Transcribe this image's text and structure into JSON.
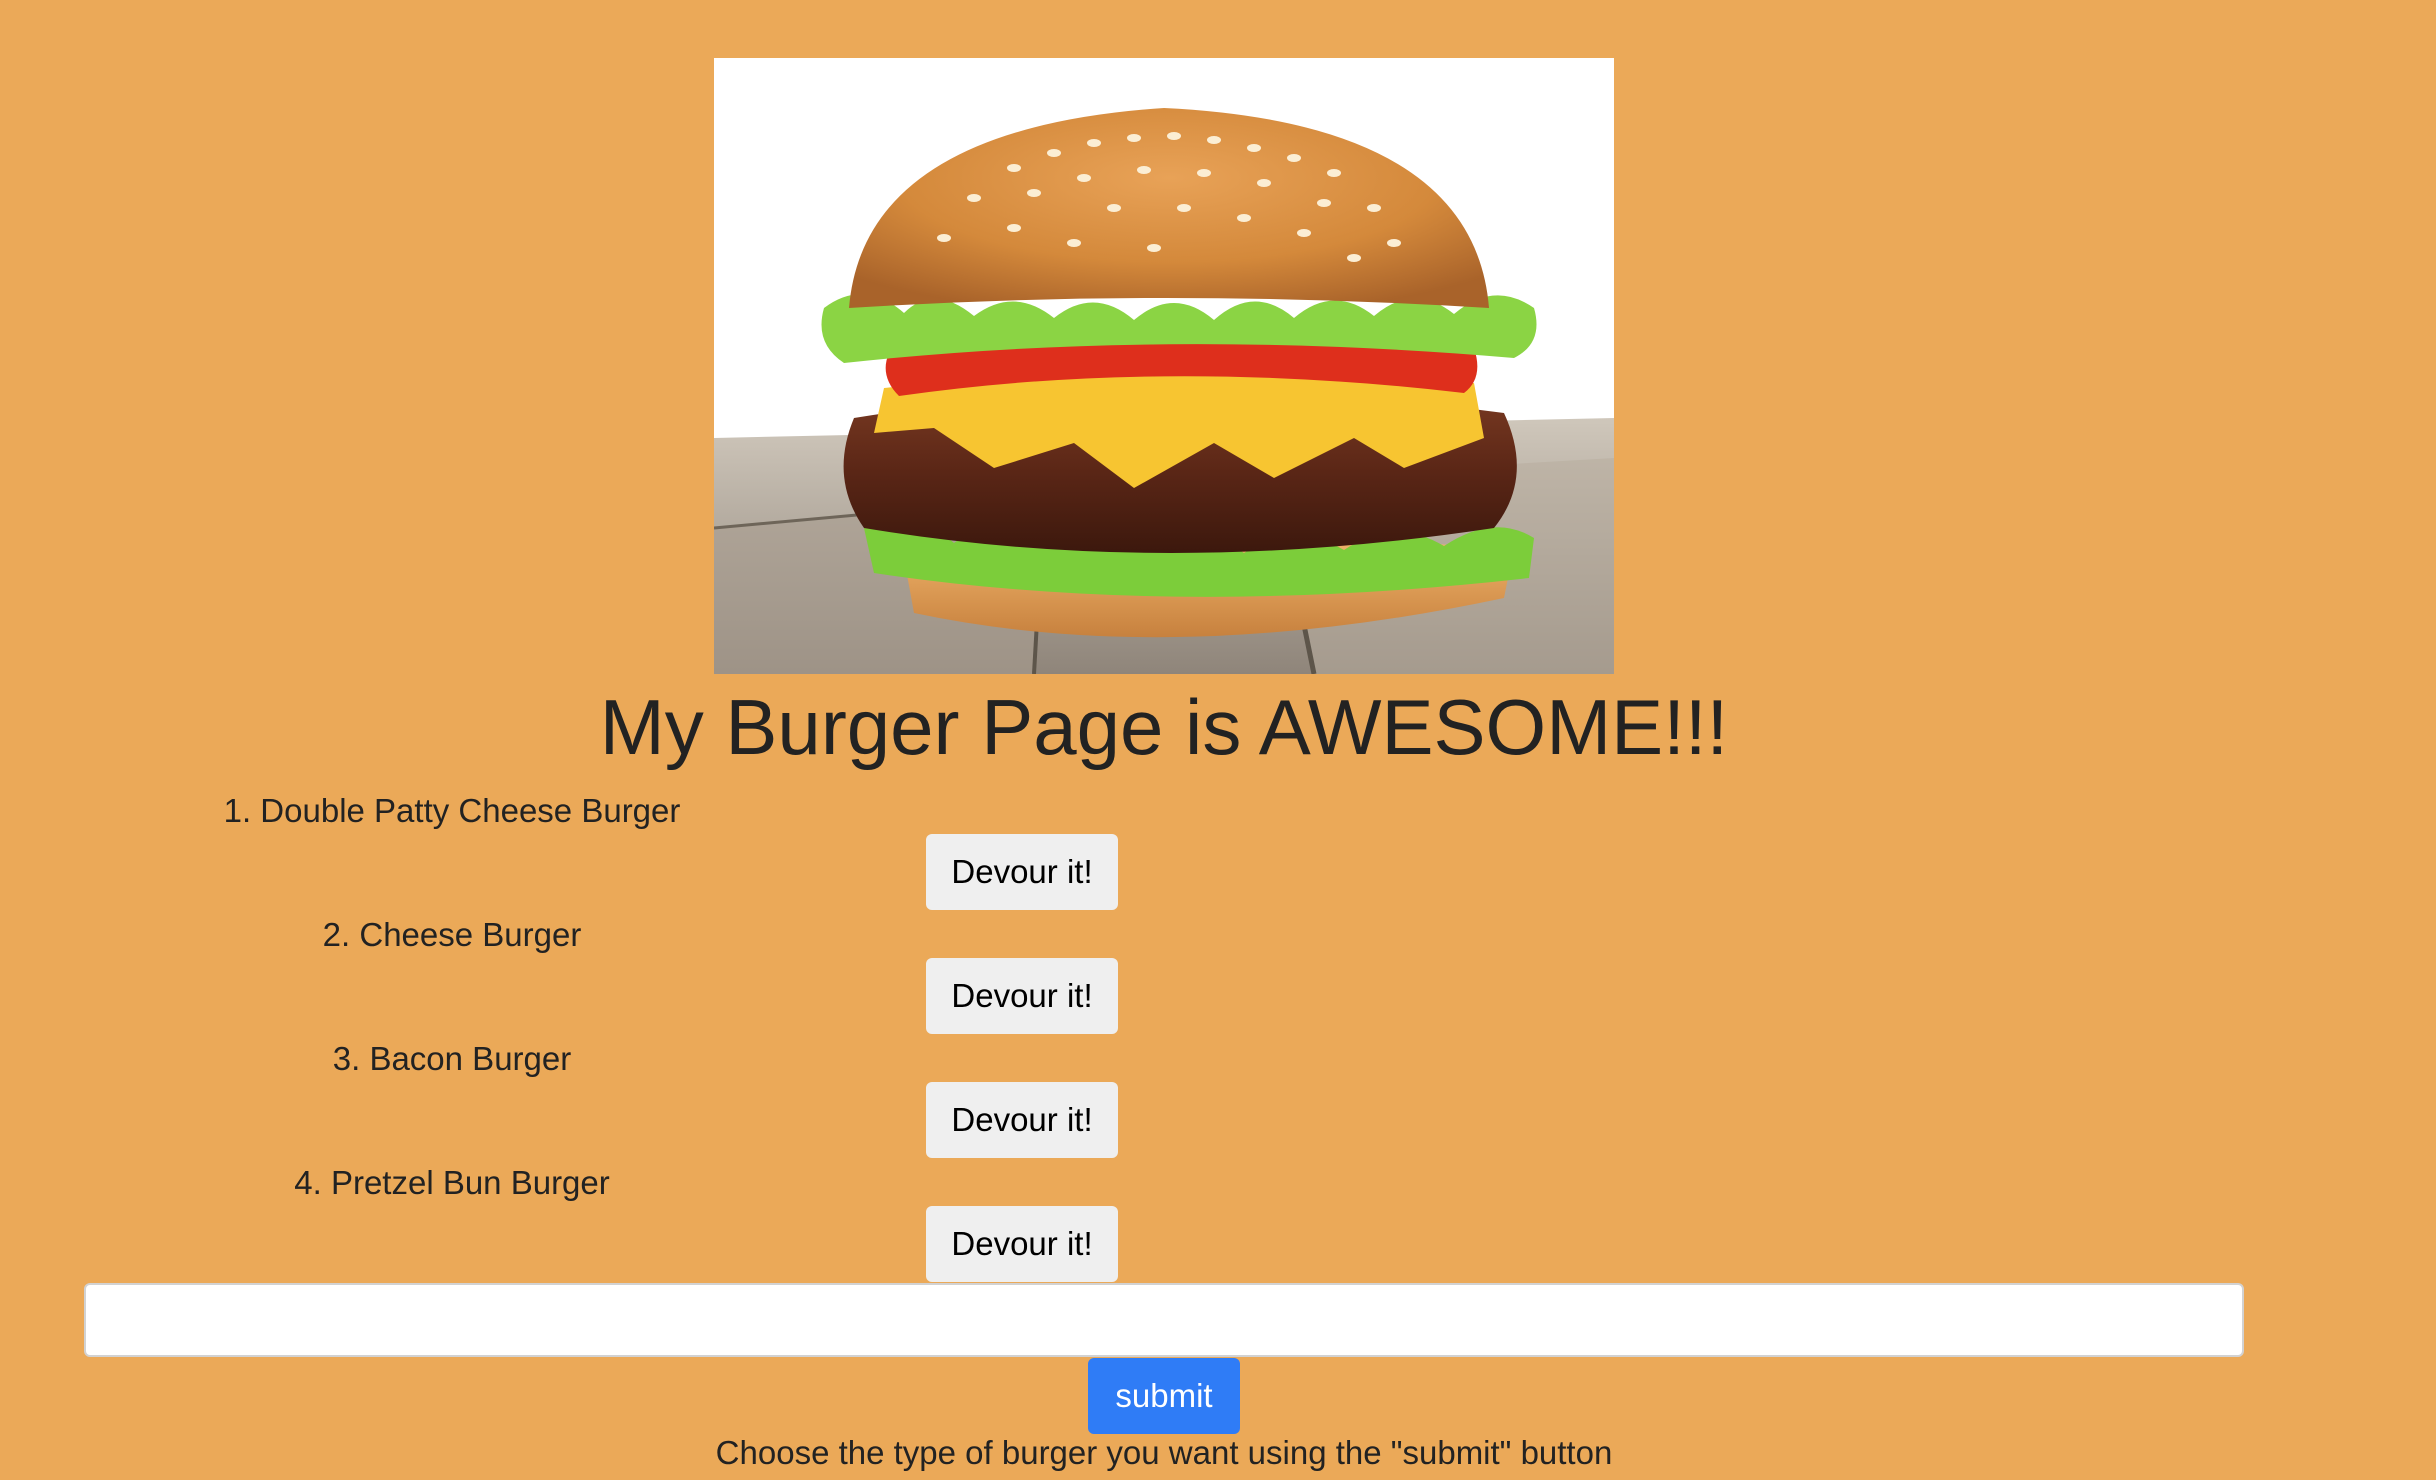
{
  "hero_image": {
    "alt": "cheeseburger-photo"
  },
  "page": {
    "title": "My Burger Page is AWESOME!!!"
  },
  "burgers": [
    {
      "label": "1. Double Patty Cheese Burger",
      "button_label": "Devour it!"
    },
    {
      "label": "2. Cheese Burger",
      "button_label": "Devour it!"
    },
    {
      "label": "3. Bacon Burger",
      "button_label": "Devour it!"
    },
    {
      "label": "4. Pretzel Bun Burger",
      "button_label": "Devour it!"
    }
  ],
  "form": {
    "input_value": "",
    "input_placeholder": "",
    "submit_label": "submit",
    "instructions": "Choose the type of burger you want using the \"submit\" button"
  },
  "colors": {
    "background": "#eba958",
    "submit_button": "#2f7cf6",
    "devour_button": "#efefef",
    "text": "#222222"
  }
}
